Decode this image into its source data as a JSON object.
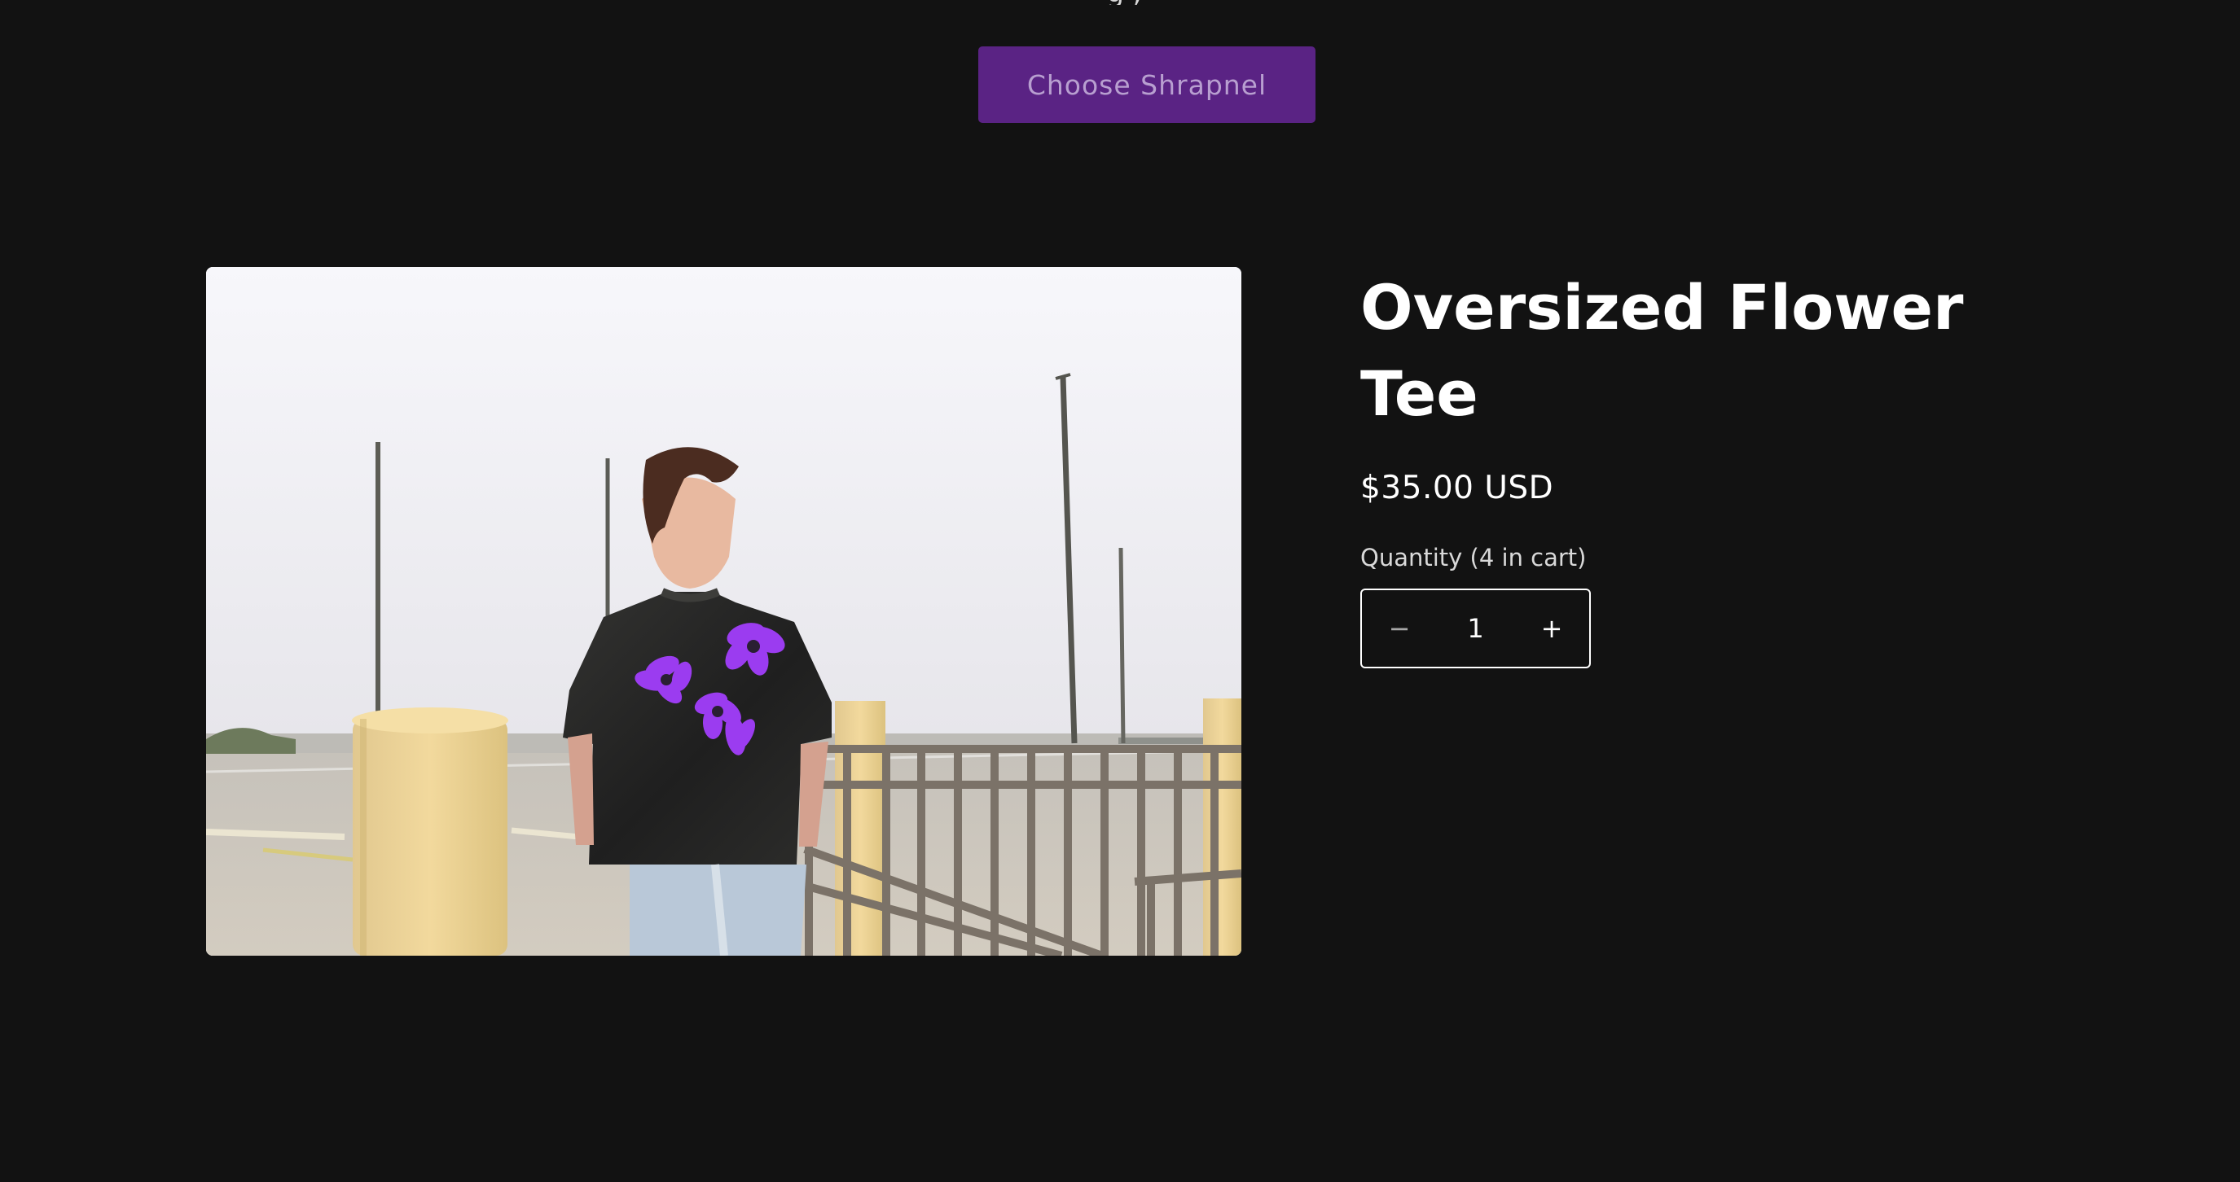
{
  "page": {
    "background": "#121212"
  },
  "cta": {
    "label": "Choose Shrapnel",
    "color": "#5a2384"
  },
  "product": {
    "title": "Oversized Flower Tee",
    "price": "$35.00 USD",
    "quantity_label": "Quantity (4 in cart)",
    "quantity_value": "1",
    "decrease_label": "−",
    "increase_label": "+"
  },
  "image": {
    "subject": "model wearing black oversized flower tee",
    "print_color": "#9b3cf0"
  }
}
